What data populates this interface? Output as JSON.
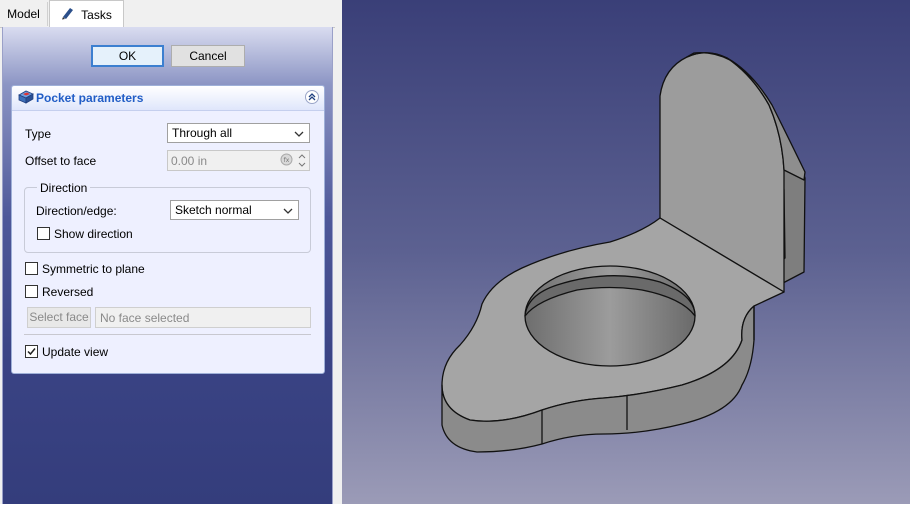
{
  "tabs": [
    {
      "label": "Model"
    },
    {
      "label": "Tasks"
    }
  ],
  "dialog": {
    "ok_label": "OK",
    "cancel_label": "Cancel"
  },
  "pocket": {
    "title": "Pocket parameters",
    "type_label": "Type",
    "type_value": "Through all",
    "offset_label": "Offset to face",
    "offset_value": "0.00 in",
    "direction_title": "Direction",
    "direction_edge_label": "Direction/edge:",
    "direction_edge_value": "Sketch normal",
    "show_direction_label": "Show direction",
    "show_direction_checked": false,
    "symmetric_label": "Symmetric to plane",
    "symmetric_checked": false,
    "reversed_label": "Reversed",
    "reversed_checked": false,
    "select_face_label": "Select face",
    "face_field_value": "No face selected",
    "update_view_label": "Update view",
    "update_view_checked": true
  },
  "colors": {
    "accent": "#215dc6",
    "viewport_top": "#3a3f78",
    "viewport_bottom": "#9b9bb7",
    "part_face": "#9a9a9a"
  }
}
